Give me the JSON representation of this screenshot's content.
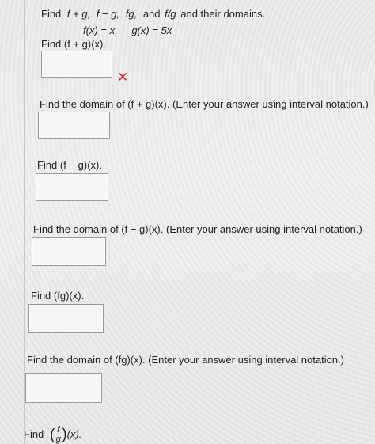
{
  "header": {
    "prompt_prefix": "Find",
    "ops": [
      "f + g,",
      "f − g,",
      "fg,",
      "and",
      "f/g",
      "and their domains."
    ],
    "f_def": "f(x) = x,",
    "g_def": "g(x) = 5x"
  },
  "questions": [
    {
      "label": "Find  (f + g)(x).",
      "status": "incorrect",
      "status_icon": "cross-icon",
      "value": ""
    },
    {
      "label": "Find the domain of  (f + g)(x).  (Enter your answer using interval notation.)",
      "value": ""
    },
    {
      "label": "Find  (f − g)(x).",
      "value": ""
    },
    {
      "label": "Find the domain of  (f − g)(x).  (Enter your answer using interval notation.)",
      "value": ""
    },
    {
      "label": "Find  (fg)(x).",
      "value": ""
    },
    {
      "label": "Find the domain of  (fg)(x).  (Enter your answer using interval notation.)",
      "value": ""
    }
  ],
  "last": {
    "prefix": "Find",
    "frac_num": "f",
    "frac_den": "g",
    "suffix": "(x)."
  },
  "colors": {
    "error": "#d02020",
    "text": "#222222"
  }
}
